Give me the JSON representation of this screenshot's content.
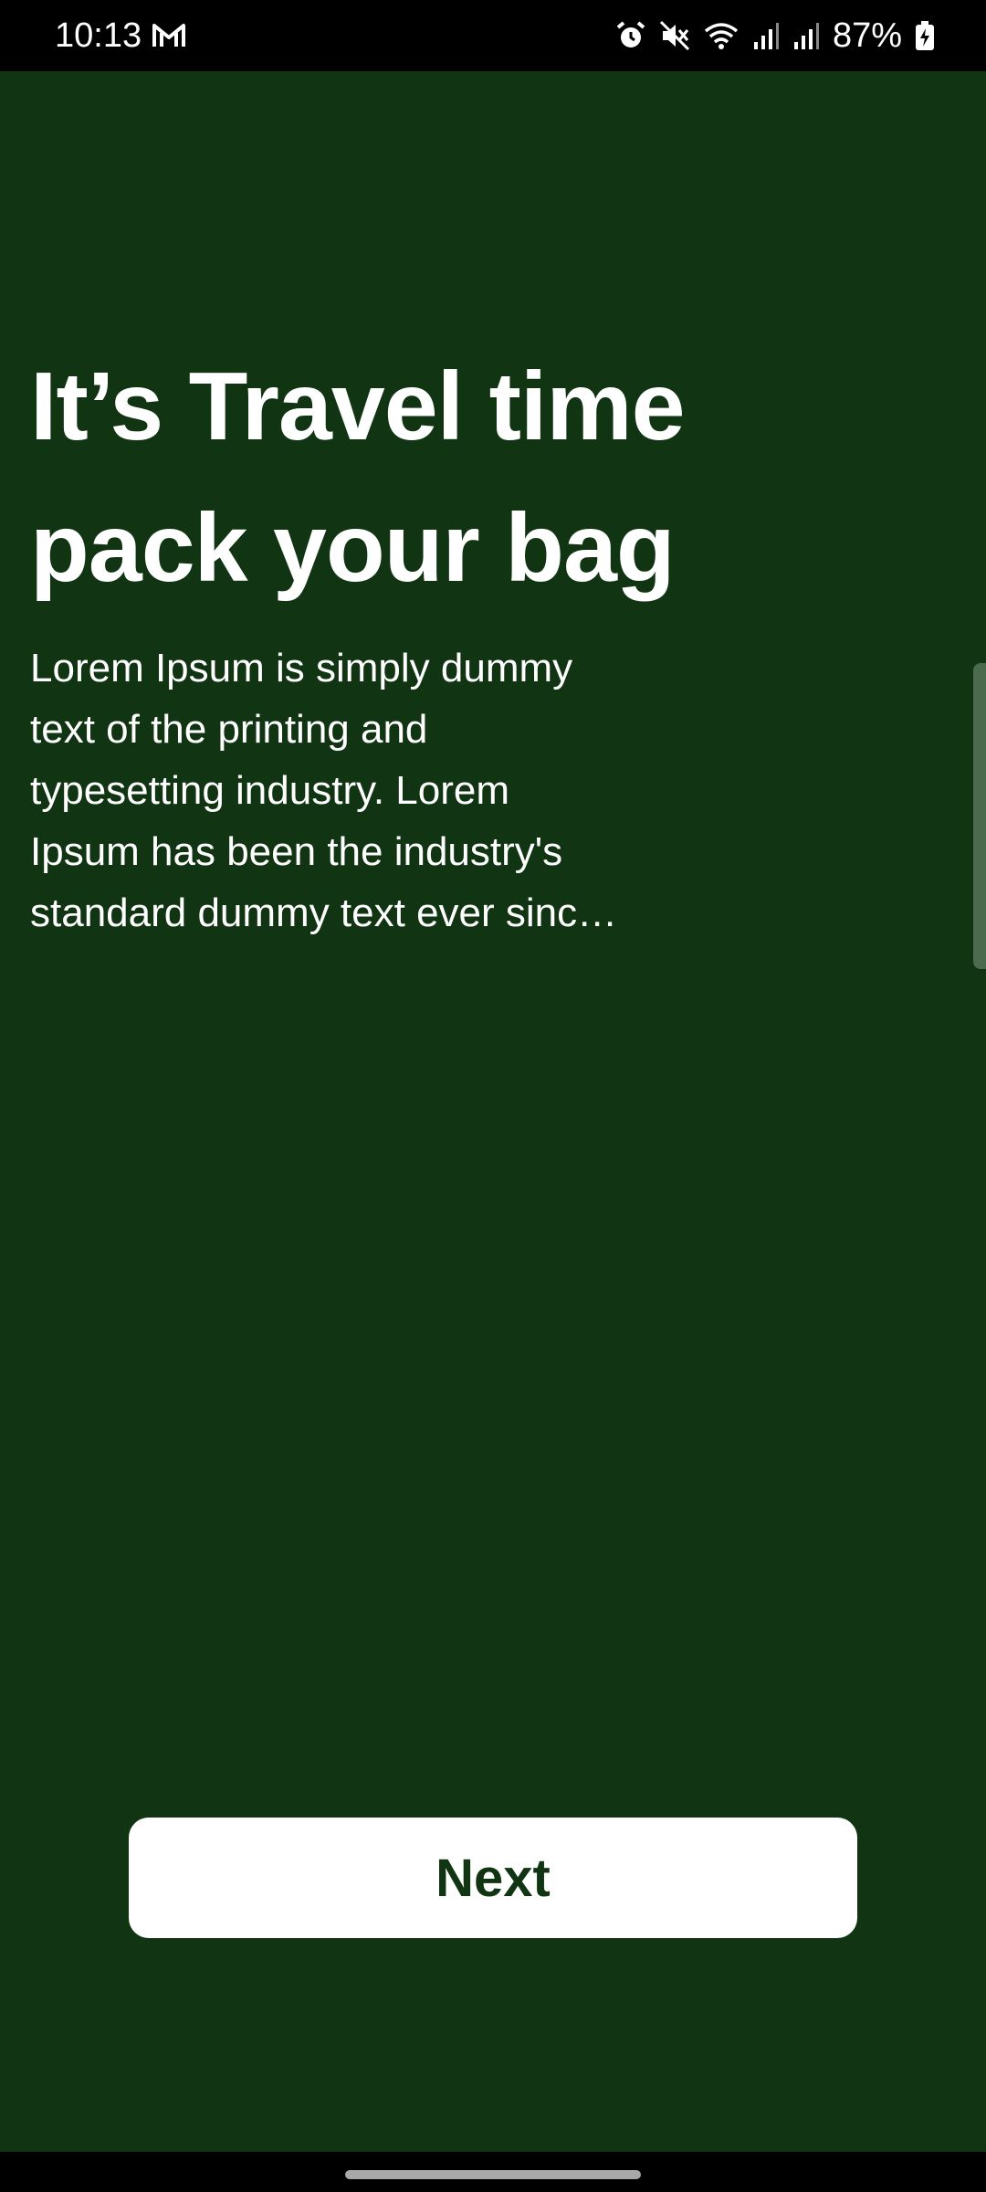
{
  "status_bar": {
    "time": "10:13",
    "battery_percent": "87%",
    "icons": [
      "gmail-icon",
      "alarm-icon",
      "mute-icon",
      "wifi-icon",
      "signal-icon",
      "signal-icon",
      "battery-charging-icon"
    ]
  },
  "onboarding": {
    "headline_line1": "It’s Travel time",
    "headline_line2": "pack your bag",
    "body_lines": [
      "Lorem Ipsum is simply dummy",
      "text of the printing and",
      "typesetting industry. Lorem",
      "Ipsum has been the industry's",
      "standard dummy text ever sinc…"
    ],
    "next_label": "Next"
  },
  "colors": {
    "background": "#113513",
    "button_background": "#ffffff",
    "button_text": "#113513",
    "text": "#ffffff"
  }
}
